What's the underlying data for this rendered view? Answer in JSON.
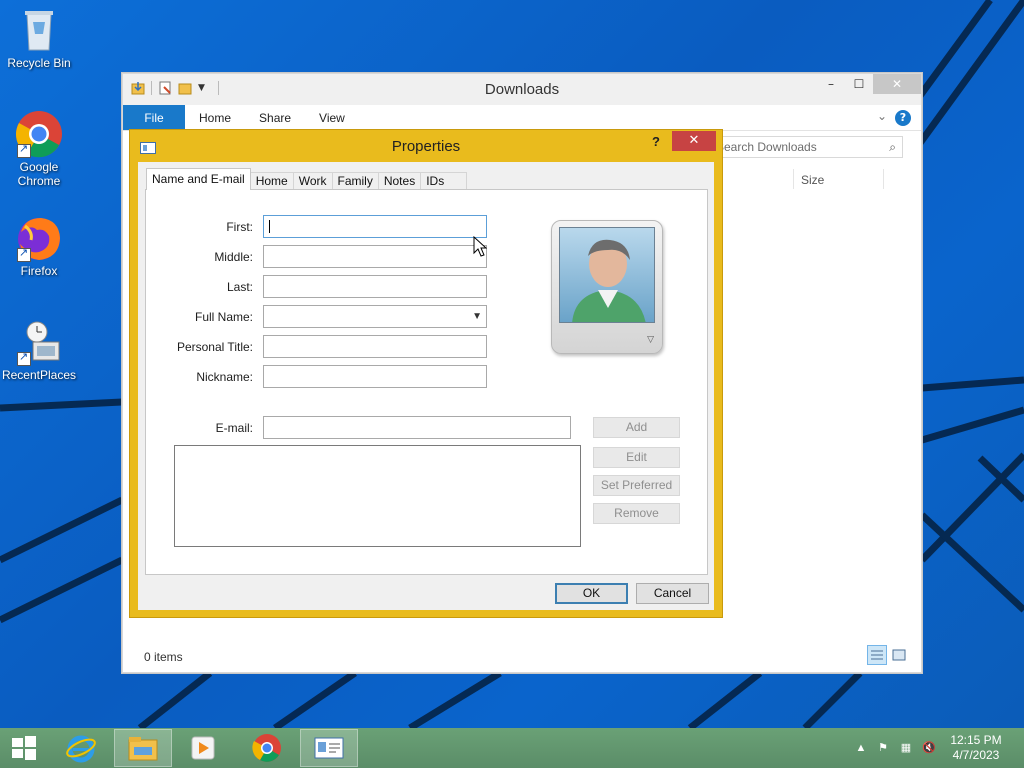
{
  "desktop": {
    "icons": [
      {
        "label": "Recycle Bin",
        "icon": "recycle-bin-icon"
      },
      {
        "label": "Google Chrome",
        "icon": "chrome-icon"
      },
      {
        "label": "Firefox",
        "icon": "firefox-icon"
      },
      {
        "label": "RecentPlaces",
        "icon": "recent-places-icon"
      }
    ]
  },
  "explorer": {
    "title": "Downloads",
    "ribbon_tabs": {
      "file": "File",
      "home": "Home",
      "share": "Share",
      "view": "View"
    },
    "search_placeholder": "Search Downloads",
    "column_size": "Size",
    "status_count": "0 items"
  },
  "dialog": {
    "title": "Properties",
    "help": "?",
    "tabs": [
      "Name and E-mail",
      "Home",
      "Work",
      "Family",
      "Notes",
      "IDs"
    ],
    "active_tab": "Name and E-mail",
    "fields": {
      "first_label": "First:",
      "middle_label": "Middle:",
      "last_label": "Last:",
      "full_name_label": "Full Name:",
      "personal_title_label": "Personal Title:",
      "nickname_label": "Nickname:",
      "email_label": "E-mail:"
    },
    "values": {
      "first": "",
      "middle": "",
      "last": "",
      "full_name": "",
      "personal_title": "",
      "nickname": "",
      "email": ""
    },
    "email_buttons": {
      "add": "Add",
      "edit": "Edit",
      "set_preferred": "Set Preferred",
      "remove": "Remove"
    },
    "ok": "OK",
    "cancel": "Cancel"
  },
  "taskbar": {
    "items": [
      "start-icon",
      "internet-explorer-icon",
      "file-explorer-icon",
      "media-player-icon",
      "chrome-icon",
      "contacts-icon"
    ],
    "active_item": "contacts-icon",
    "clock_time": "12:15 PM",
    "clock_date": "4/7/2023"
  },
  "colors": {
    "dialog_frame": "#e9bb1d",
    "file_tab": "#1979ca",
    "taskbar": "#5d8f6a",
    "close_button": "#c74343"
  }
}
